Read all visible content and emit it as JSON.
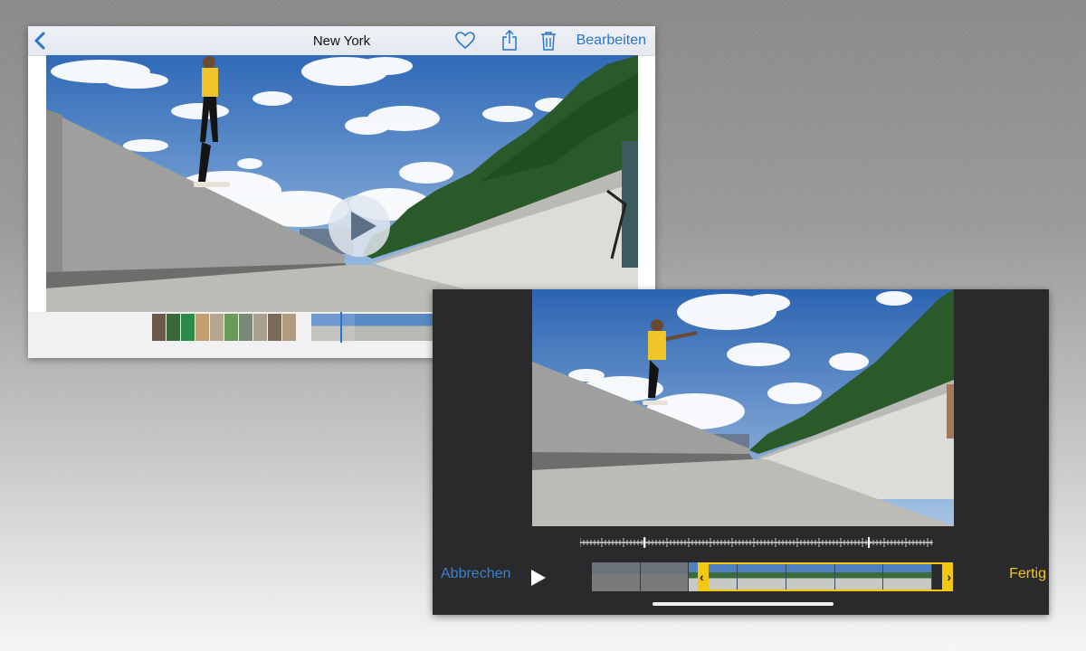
{
  "viewer": {
    "title": "New York",
    "edit_label": "Bearbeiten",
    "icons": [
      "back-chevron-icon",
      "heart-icon",
      "share-icon",
      "trash-icon",
      "play-icon"
    ],
    "accent": "#2a74c9"
  },
  "trim_editor": {
    "cancel_label": "Abbrechen",
    "done_label": "Fertig",
    "accent_cancel": "#3b7fcf",
    "accent_done": "#f2c418",
    "trim_handle_color": "#f3c80f",
    "handles": [
      "‹",
      "›"
    ],
    "frame_count": 7
  }
}
